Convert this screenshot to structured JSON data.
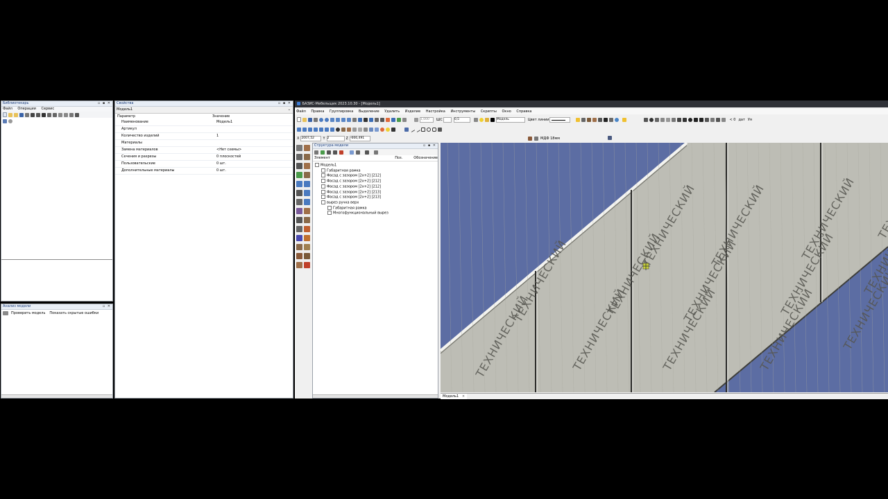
{
  "library_panel": {
    "title": "Библиотекарь",
    "menu": [
      "Файл",
      "Операции",
      "Сервис"
    ]
  },
  "analysis_panel": {
    "title": "Анализ модели",
    "check_label": "Проверить модель",
    "hidden_errors_label": "Показать скрытые ошибки"
  },
  "properties_panel": {
    "title": "Свойства",
    "object": "Модель1",
    "header_param": "Параметр",
    "header_value": "Значение",
    "rows": [
      {
        "param": "Наименование",
        "value": "Модель1"
      },
      {
        "param": "Артикул",
        "value": ""
      },
      {
        "param": "Количество изделий",
        "value": "1"
      },
      {
        "param": "Материалы",
        "value": ""
      },
      {
        "param": "Замена материалов",
        "value": "<Нет схемы>"
      },
      {
        "param": "Сечения и разрезы",
        "value": "0 плоскостей"
      },
      {
        "param": "Пользовательские",
        "value": "0 шт."
      },
      {
        "param": "Дополнительные материалы",
        "value": "0 шт."
      }
    ]
  },
  "app": {
    "title": "БАЗИС-Мебельщик 2023.10.30 - [Модель1]",
    "menu": [
      "Файл",
      "Правка",
      "Группировка",
      "Выделение",
      "Удалить",
      "Изделие",
      "Настройка",
      "Инструменты",
      "Скрипты",
      "Окно",
      "Справка"
    ],
    "toolbar": {
      "scale_value": "1,000",
      "mc_label": "ШС",
      "line_width": "0,5",
      "layer": "Модель",
      "line_color_label": "Цвет линии",
      "right_label_1": "< 0",
      "right_label_2": "дат",
      "right_label_3": "Уя"
    },
    "coords": {
      "x_label": "X",
      "x_value": "2007,52",
      "y_label": "Y",
      "y_value": "2",
      "z_label": "Z",
      "z_value": "-666,491"
    },
    "material_label": "МДФ 18мм",
    "tab_label": "Модель1",
    "tab_close": "×"
  },
  "structure_panel": {
    "title": "Структура модели",
    "col_element": "Элемент",
    "col_pos": "Поз.",
    "col_designation": "Обозначение",
    "items": [
      {
        "label": "Модель1",
        "level": 0
      },
      {
        "label": "Габаритная рамка",
        "level": 1
      },
      {
        "label": "Фасад с зазором [2х+2] [212]",
        "level": 1
      },
      {
        "label": "Фасад с зазором [2х+2] [212]",
        "level": 1
      },
      {
        "label": "Фасад с зазором [2х+2] [212]",
        "level": 1
      },
      {
        "label": "Фасад с зазором [2х+2] [213]",
        "level": 1
      },
      {
        "label": "Фасад с зазором [2х+2] [213]",
        "level": 1
      },
      {
        "label": "вырез ручка верх",
        "level": 1
      },
      {
        "label": "Габаритная рамка",
        "level": 2
      },
      {
        "label": "Многофункциональный вырез",
        "level": 2
      }
    ]
  },
  "viewport": {
    "panel_text": "ТЕХНИЧЕСКИЙ",
    "background": "#5c6da3",
    "panel_color": "#bdbdb5"
  }
}
